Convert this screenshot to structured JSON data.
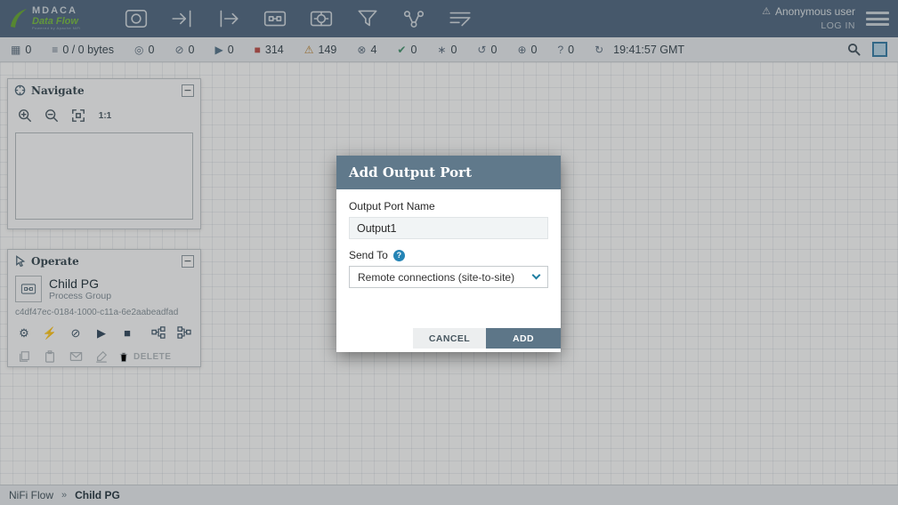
{
  "header": {
    "brand": {
      "name": "MDACA",
      "product": "Data Flow",
      "tagline": "Powered by Apache NiFi"
    },
    "tools": [
      {
        "name": "processor"
      },
      {
        "name": "input-port"
      },
      {
        "name": "output-port"
      },
      {
        "name": "process-group"
      },
      {
        "name": "remote-process-group"
      },
      {
        "name": "funnel"
      },
      {
        "name": "template"
      },
      {
        "name": "label"
      }
    ],
    "user": {
      "warning_glyph": "⚠",
      "name": "Anonymous user",
      "login_label": "LOG IN"
    }
  },
  "status_bar": {
    "items": [
      {
        "name": "active-threads",
        "glyph": "▦",
        "value": "0"
      },
      {
        "name": "queued",
        "glyph": "≡",
        "value": "0 / 0 bytes"
      },
      {
        "name": "transmitting",
        "glyph": "◎",
        "value": "0"
      },
      {
        "name": "not-transmitting",
        "glyph": "⊘",
        "value": "0"
      },
      {
        "name": "running",
        "glyph": "▶",
        "value": "0"
      },
      {
        "name": "stopped",
        "glyph": "■",
        "value": "314"
      },
      {
        "name": "invalid",
        "glyph": "⚠",
        "value": "149"
      },
      {
        "name": "disabled",
        "glyph": "⊗",
        "value": "4"
      },
      {
        "name": "up-to-date",
        "glyph": "✔",
        "value": "0"
      },
      {
        "name": "locally-modified",
        "glyph": "∗",
        "value": "0"
      },
      {
        "name": "stale",
        "glyph": "↺",
        "value": "0"
      },
      {
        "name": "locally-modified-stale",
        "glyph": "⊕",
        "value": "0"
      },
      {
        "name": "sync-failure",
        "glyph": "?",
        "value": "0"
      }
    ],
    "refresh": {
      "glyph": "↻",
      "time": "19:41:57 GMT"
    }
  },
  "navigate": {
    "title": "Navigate",
    "collapse_glyph": "−",
    "actual_size_label": "1:1"
  },
  "operate": {
    "title": "Operate",
    "collapse_glyph": "−",
    "component_name": "Child PG",
    "component_type": "Process Group",
    "component_id": "c4df47ec-0184-1000-c11a-6e2aabeadfad",
    "buttons": {
      "configure": "⚙",
      "enable": "⚡",
      "disable": "⊘",
      "start": "▶",
      "stop": "■"
    },
    "delete_label": "DELETE"
  },
  "modal": {
    "title": "Add Output Port",
    "name_label": "Output Port Name",
    "name_value": "Output1",
    "send_to_label": "Send To",
    "help_glyph": "?",
    "send_to_value": "Remote connections (site-to-site)",
    "cancel_label": "CANCEL",
    "add_label": "ADD"
  },
  "breadcrumb": {
    "root": "NiFi Flow",
    "separator": "»",
    "current": "Child PG"
  },
  "colors": {
    "accent": "#60798b",
    "stopped_red": "#c05a55",
    "invalid_amber": "#bf8b3f",
    "link_blue": "#1e7ea1",
    "brand_green": "#7fc24c"
  }
}
